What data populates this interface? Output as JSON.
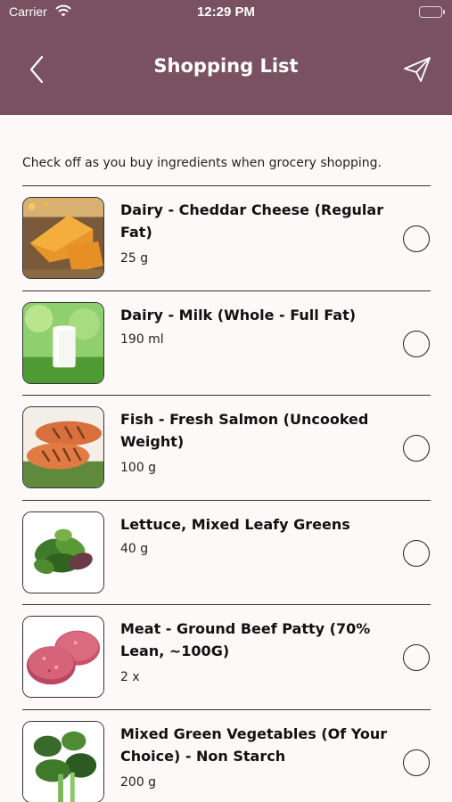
{
  "status_bar": {
    "carrier": "Carrier",
    "time": "12:29 PM"
  },
  "header": {
    "title": "Shopping List",
    "back_icon": "chevron-left-icon",
    "send_icon": "paper-plane-icon"
  },
  "intro": "Check off as you buy ingredients when grocery shopping.",
  "items": [
    {
      "name": "Dairy - Cheddar Cheese (Regular Fat)",
      "qty": "25 g",
      "checked": false,
      "image": "cheddar-cheese-photo"
    },
    {
      "name": "Dairy - Milk (Whole - Full Fat)",
      "qty": "190 ml",
      "checked": false,
      "image": "milk-glass-photo"
    },
    {
      "name": "Fish - Fresh Salmon (Uncooked Weight)",
      "qty": "100 g",
      "checked": false,
      "image": "salmon-photo"
    },
    {
      "name": "Lettuce, Mixed Leafy Greens",
      "qty": "40 g",
      "checked": false,
      "image": "leafy-greens-photo"
    },
    {
      "name": "Meat - Ground Beef Patty (70% Lean, ~100G)",
      "qty": "2 x",
      "checked": false,
      "image": "beef-patty-photo"
    },
    {
      "name": "Mixed Green Vegetables (Of Your Choice) - Non Starch",
      "qty": "200 g",
      "checked": false,
      "image": "green-vegetables-photo"
    }
  ],
  "colors": {
    "header_bg": "#7a5160",
    "page_bg": "#fdf9f9",
    "text": "#111111"
  }
}
